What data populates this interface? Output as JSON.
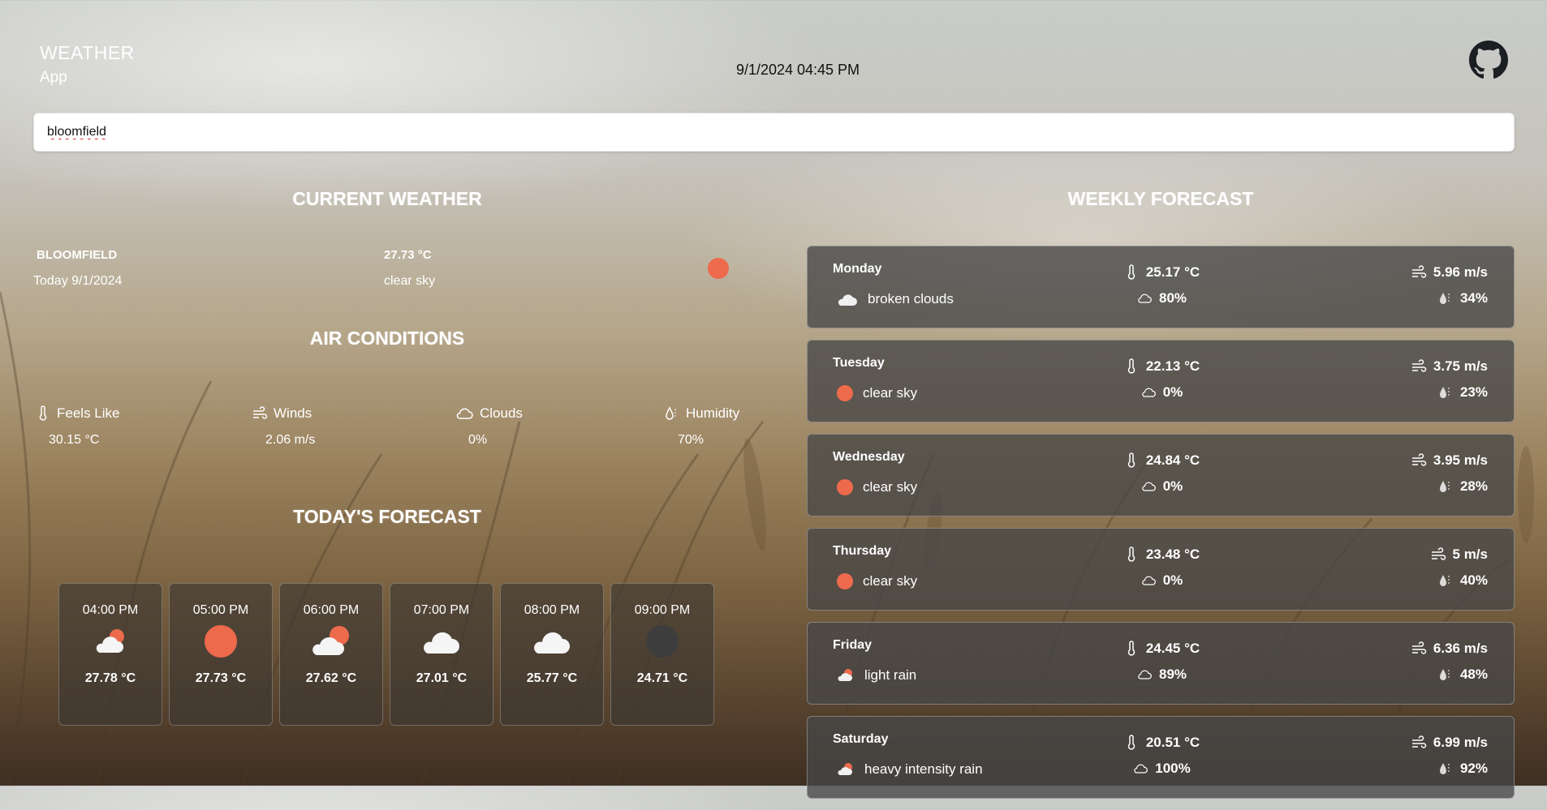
{
  "header": {
    "brand_line1": "WEATHER",
    "brand_line2": "App",
    "datetime": "9/1/2024 04:45 PM",
    "github_icon": "github-icon"
  },
  "search": {
    "value": "bloomfield",
    "placeholder": ""
  },
  "current": {
    "title": "CURRENT WEATHER",
    "city": "BLOOMFIELD",
    "date": "Today 9/1/2024",
    "temp": "27.73 °C",
    "description": "clear sky",
    "icon": "sun-icon"
  },
  "air": {
    "title": "AIR CONDITIONS",
    "items": [
      {
        "label": "Feels Like",
        "value": "30.15 °C",
        "icon": "thermometer-icon"
      },
      {
        "label": "Winds",
        "value": "2.06 m/s",
        "icon": "wind-icon"
      },
      {
        "label": "Clouds",
        "value": "0%",
        "icon": "cloud-icon"
      },
      {
        "label": "Humidity",
        "value": "70%",
        "icon": "humidity-icon"
      }
    ]
  },
  "today": {
    "title": "TODAY'S FORECAST",
    "hours": [
      {
        "time": "04:00 PM",
        "temp": "27.78 °C",
        "icon": "cloud-sun-icon"
      },
      {
        "time": "05:00 PM",
        "temp": "27.73 °C",
        "icon": "sun-icon"
      },
      {
        "time": "06:00 PM",
        "temp": "27.62 °C",
        "icon": "cloud-sun-icon"
      },
      {
        "time": "07:00 PM",
        "temp": "27.01 °C",
        "icon": "cloud-icon"
      },
      {
        "time": "08:00 PM",
        "temp": "25.77 °C",
        "icon": "cloud-icon"
      },
      {
        "time": "09:00 PM",
        "temp": "24.71 °C",
        "icon": "moon-icon"
      }
    ]
  },
  "weekly": {
    "title": "WEEKLY FORECAST",
    "days": [
      {
        "day": "Monday",
        "desc": "broken clouds",
        "icon": "cloud-icon",
        "temp": "25.17 °C",
        "clouds": "80%",
        "wind": "5.96 m/s",
        "humidity": "34%"
      },
      {
        "day": "Tuesday",
        "desc": "clear sky",
        "icon": "sun-icon",
        "temp": "22.13 °C",
        "clouds": "0%",
        "wind": "3.75 m/s",
        "humidity": "23%"
      },
      {
        "day": "Wednesday",
        "desc": "clear sky",
        "icon": "sun-icon",
        "temp": "24.84 °C",
        "clouds": "0%",
        "wind": "3.95 m/s",
        "humidity": "28%"
      },
      {
        "day": "Thursday",
        "desc": "clear sky",
        "icon": "sun-icon",
        "temp": "23.48 °C",
        "clouds": "0%",
        "wind": "5 m/s",
        "humidity": "40%"
      },
      {
        "day": "Friday",
        "desc": "light rain",
        "icon": "rain-icon",
        "temp": "24.45 °C",
        "clouds": "89%",
        "wind": "6.36 m/s",
        "humidity": "48%"
      },
      {
        "day": "Saturday",
        "desc": "heavy intensity rain",
        "icon": "rain-icon",
        "temp": "20.51 °C",
        "clouds": "100%",
        "wind": "6.99 m/s",
        "humidity": "92%"
      }
    ]
  },
  "colors": {
    "sun": "#ee6a4c",
    "moon": "#3d3d3d",
    "card": "#464646"
  }
}
